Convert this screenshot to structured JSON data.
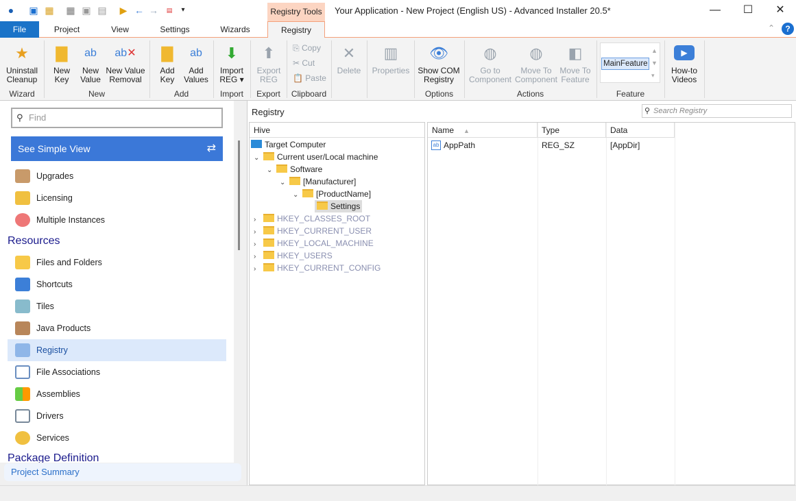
{
  "window": {
    "title": "Your Application - New Project (English US) - Advanced Installer 20.5*",
    "context_tab": "Registry Tools",
    "minimize": "—",
    "maximize": "☐",
    "close": "✕"
  },
  "tabs": [
    "File",
    "Project",
    "View",
    "Settings",
    "Wizards",
    "Registry"
  ],
  "ribbon": {
    "buttons": [
      {
        "l1": "Uninstall",
        "l2": "Cleanup",
        "icon": "wand-icon"
      },
      {
        "l1": "New",
        "l2": "Key",
        "icon": "folder-icon"
      },
      {
        "l1": "New",
        "l2": "Value",
        "icon": "ab-plus-icon"
      },
      {
        "l1": "New Value",
        "l2": "Removal",
        "icon": "ab-x-icon"
      },
      {
        "l1": "Add",
        "l2": "Key",
        "icon": "folder-plus-icon"
      },
      {
        "l1": "Add",
        "l2": "Values",
        "icon": "ab-plus-icon"
      },
      {
        "l1": "Import",
        "l2": "REG ▾",
        "icon": "import-icon"
      },
      {
        "l1": "Export",
        "l2": "REG",
        "icon": "export-icon",
        "disabled": true
      },
      {
        "l1": "Delete",
        "l2": "",
        "icon": "delete-icon",
        "disabled": true
      },
      {
        "l1": "Properties",
        "l2": "",
        "icon": "properties-icon",
        "disabled": true
      },
      {
        "l1": "Show COM",
        "l2": "Registry",
        "icon": "com-icon"
      },
      {
        "l1": "Go to",
        "l2": "Component",
        "icon": "goto-icon",
        "disabled": true
      },
      {
        "l1": "Move To",
        "l2": "Component",
        "icon": "move-component-icon",
        "disabled": true
      },
      {
        "l1": "Move To",
        "l2": "Feature",
        "icon": "move-feature-icon",
        "disabled": true
      },
      {
        "l1": "How-to",
        "l2": "Videos",
        "icon": "video-icon"
      }
    ],
    "clipboard": [
      "Copy",
      "Cut",
      "Paste"
    ],
    "groups": [
      "Wizard",
      "New",
      "Add",
      "Import",
      "Export",
      "Clipboard",
      "Options",
      "Actions",
      "Feature"
    ],
    "feature_value": "MainFeature"
  },
  "sidebar": {
    "find_placeholder": "Find",
    "simple_view": "See Simple View",
    "items_top": [
      "Upgrades",
      "Licensing",
      "Multiple Instances"
    ],
    "section_resources": "Resources",
    "items_resources": [
      "Files and Folders",
      "Shortcuts",
      "Tiles",
      "Java Products",
      "Registry",
      "File Associations",
      "Assemblies",
      "Drivers",
      "Services"
    ],
    "section_package": "Package Definition",
    "project_summary": "Project Summary",
    "selected": "Registry"
  },
  "main": {
    "title": "Registry",
    "search_placeholder": "Search Registry",
    "hive_header": "Hive",
    "tree": [
      "Target Computer",
      "Current user/Local machine",
      "Software",
      "[Manufacturer]",
      "[ProductName]",
      "Settings",
      "HKEY_CLASSES_ROOT",
      "HKEY_CURRENT_USER",
      "HKEY_LOCAL_MACHINE",
      "HKEY_USERS",
      "HKEY_CURRENT_CONFIG"
    ],
    "columns": [
      "Name",
      "Type",
      "Data"
    ],
    "rows": [
      {
        "name": "AppPath",
        "type": "REG_SZ",
        "data": "[AppDir]"
      }
    ]
  },
  "colors": {
    "accent": "#1a73c8",
    "simple_view": "#3b78d8",
    "context_tab": "#fcd5c2",
    "selected_item": "#dce9fb"
  }
}
